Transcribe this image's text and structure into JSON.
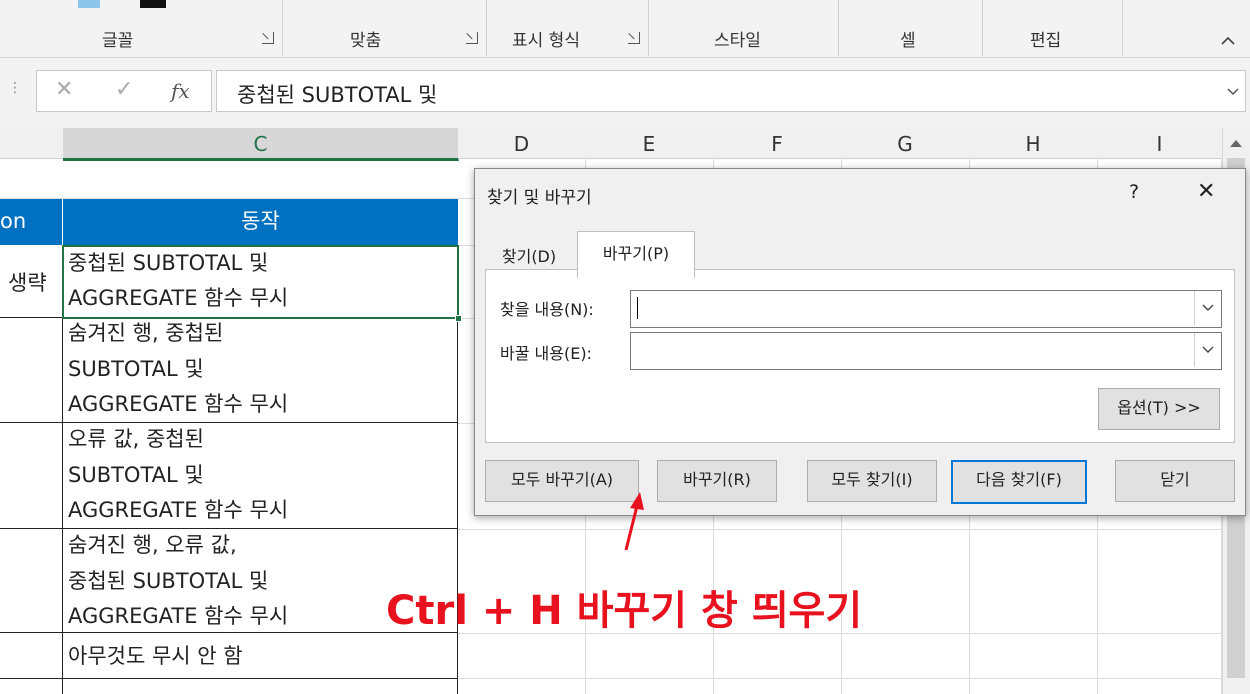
{
  "ribbon": {
    "groups": [
      "글꼴",
      "맞춤",
      "표시 형식",
      "스타일",
      "셀",
      "편집"
    ],
    "collapse_icon": "chevron-up-icon"
  },
  "formula_bar": {
    "cancel_symbol": "✕",
    "enter_symbol": "✓",
    "fx_label": "fx",
    "content": "중첩된 SUBTOTAL 및"
  },
  "columns": [
    "C",
    "D",
    "E",
    "F",
    "G",
    "H",
    "I"
  ],
  "sheet": {
    "header_b_partial": "on",
    "header_c": "동작",
    "b_partial_value": "생략",
    "rows": [
      [
        "중첩된 SUBTOTAL 및",
        "AGGREGATE 함수 무시"
      ],
      [
        "숨겨진 행, 중첩된",
        "SUBTOTAL 및",
        "AGGREGATE 함수 무시"
      ],
      [
        "오류 값, 중첩된",
        "SUBTOTAL 및",
        "AGGREGATE 함수 무시"
      ],
      [
        "숨겨진 행, 오류 값,",
        "중첩된 SUBTOTAL 및",
        "AGGREGATE 함수 무시"
      ],
      [
        "아무것도 무시 안 함"
      ]
    ],
    "header_bg": "#0070c0"
  },
  "dialog": {
    "title": "찾기 및 바꾸기",
    "help": "?",
    "close": "✕",
    "tabs": [
      "찾기(D)",
      "바꾸기(P)"
    ],
    "active_tab": "바꾸기(P)",
    "find_label": "찾을 내용(N):",
    "replace_label": "바꿀 내용(E):",
    "find_value": "",
    "replace_value": "",
    "options_button": "옵션(T) >>",
    "buttons": {
      "replace_all": "모두 바꾸기(A)",
      "replace": "바꾸기(R)",
      "find_all": "모두 찾기(I)",
      "find_next": "다음 찾기(F)",
      "close": "닫기"
    }
  },
  "annotation": {
    "text": "Ctrl + H 바꾸기 창 띄우기",
    "color": "#e8121e"
  }
}
